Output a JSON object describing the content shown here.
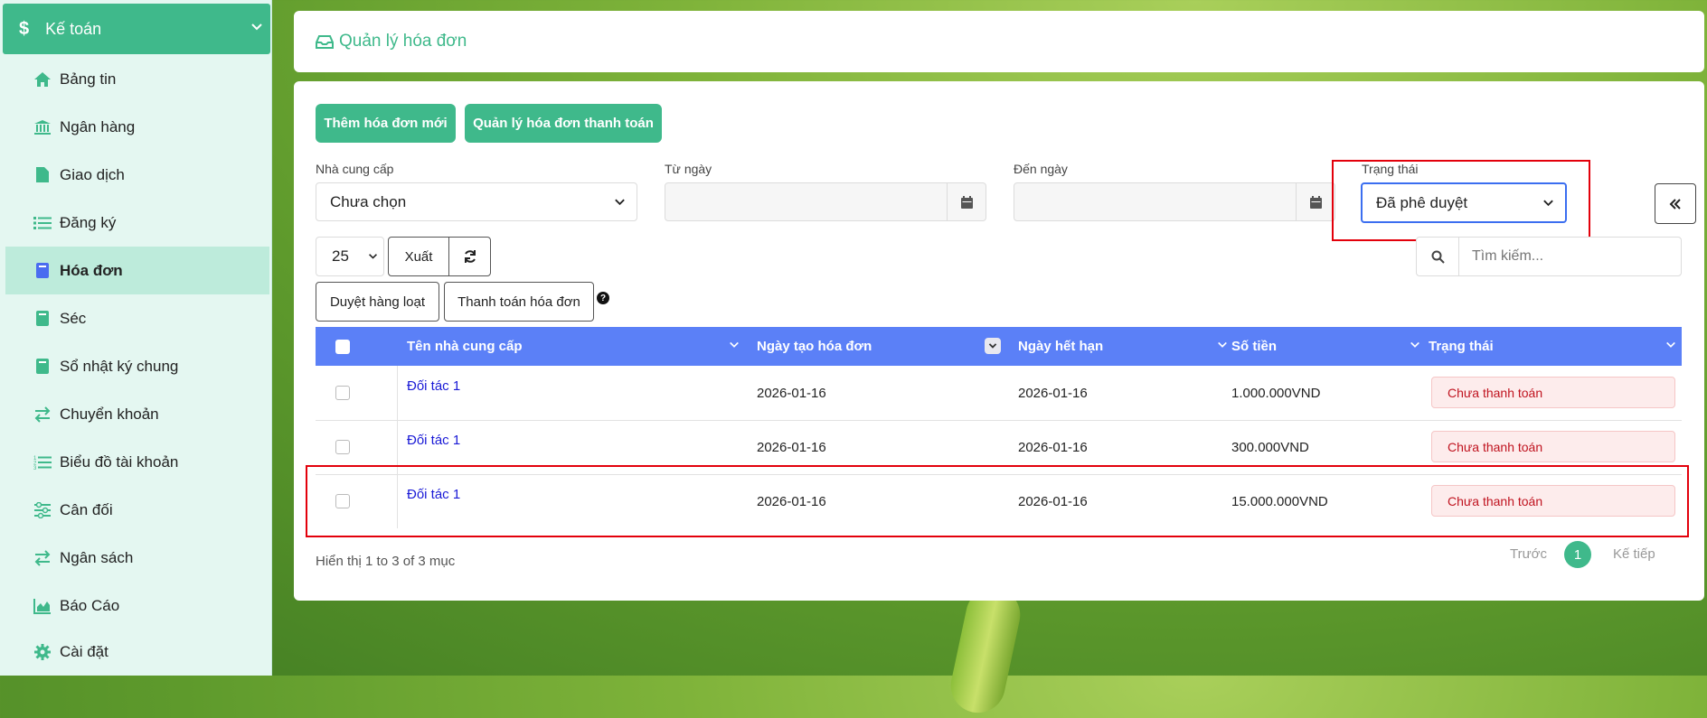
{
  "sidebar": {
    "header": "Kế toán",
    "items": [
      {
        "label": "Bảng tin"
      },
      {
        "label": "Ngân hàng"
      },
      {
        "label": "Giao dịch"
      },
      {
        "label": "Đăng ký"
      },
      {
        "label": "Hóa đơn"
      },
      {
        "label": "Séc"
      },
      {
        "label": "Sổ nhật ký chung"
      },
      {
        "label": "Chuyển khoản"
      },
      {
        "label": "Biểu đồ tài khoản"
      },
      {
        "label": "Cân đối"
      },
      {
        "label": "Ngân sách"
      },
      {
        "label": "Báo Cáo"
      },
      {
        "label": "Cài đặt"
      }
    ],
    "active_index": 4
  },
  "page": {
    "title": "Quản lý hóa đơn"
  },
  "toolbar": {
    "add_invoice": "Thêm hóa đơn mới",
    "manage_payments": "Quản lý hóa đơn thanh toán"
  },
  "filters": {
    "supplier_label": "Nhà cung cấp",
    "supplier_value": "Chưa chọn",
    "from_label": "Từ ngày",
    "to_label": "Đến ngày",
    "status_label": "Trạng thái",
    "status_value": "Đã phê duyệt"
  },
  "table_controls": {
    "page_size": "25",
    "export": "Xuất",
    "search_placeholder": "Tìm kiếm...",
    "bulk_approve": "Duyệt hàng loạt",
    "pay_invoices": "Thanh toán hóa đơn"
  },
  "table": {
    "columns": [
      "Tên nhà cung cấp",
      "Ngày tạo hóa đơn",
      "Ngày hết hạn",
      "Số tiền",
      "Trạng thái"
    ],
    "rows": [
      {
        "supplier": "Đối tác 1",
        "created": "2026-01-16",
        "due": "2026-01-16",
        "amount": "1.000.000VND",
        "status": "Chưa thanh toán"
      },
      {
        "supplier": "Đối tác 1",
        "created": "2026-01-16",
        "due": "2026-01-16",
        "amount": "300.000VND",
        "status": "Chưa thanh toán"
      },
      {
        "supplier": "Đối tác 1",
        "created": "2026-01-16",
        "due": "2026-01-16",
        "amount": "15.000.000VND",
        "status": "Chưa thanh toán"
      }
    ]
  },
  "footer": {
    "info": "Hiển thị 1 to 3 of 3 mục",
    "prev": "Trước",
    "page": "1",
    "next": "Kế tiếp"
  },
  "colors": {
    "accent": "#3fb98b",
    "table_header": "#5b80f7",
    "highlight": "#e3000b",
    "badge_text": "#c0131f"
  }
}
